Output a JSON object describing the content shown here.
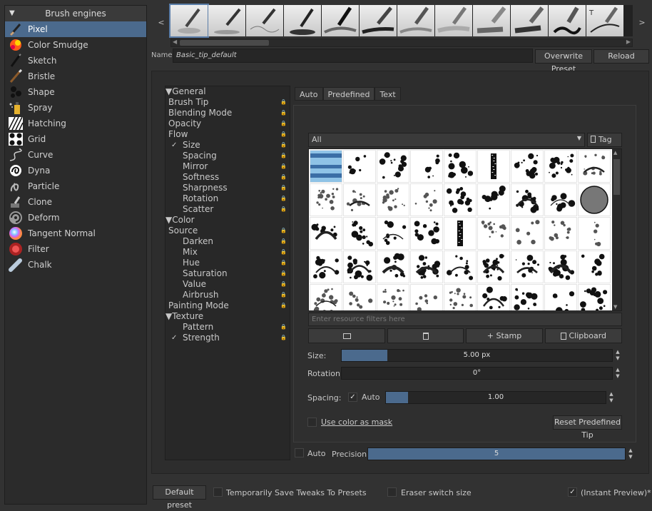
{
  "engines_panel": {
    "title": "Brush engines",
    "items": [
      {
        "label": "Pixel",
        "icon": "pixel-brush-icon",
        "selected": true
      },
      {
        "label": "Color Smudge",
        "icon": "color-smudge-icon"
      },
      {
        "label": "Sketch",
        "icon": "sketch-icon"
      },
      {
        "label": "Bristle",
        "icon": "bristle-icon"
      },
      {
        "label": "Shape",
        "icon": "shape-icon"
      },
      {
        "label": "Spray",
        "icon": "spray-icon"
      },
      {
        "label": "Hatching",
        "icon": "hatching-icon"
      },
      {
        "label": "Grid",
        "icon": "grid-icon"
      },
      {
        "label": "Curve",
        "icon": "curve-icon"
      },
      {
        "label": "Dyna",
        "icon": "dyna-icon"
      },
      {
        "label": "Particle",
        "icon": "particle-icon"
      },
      {
        "label": "Clone",
        "icon": "clone-icon"
      },
      {
        "label": "Deform",
        "icon": "deform-icon"
      },
      {
        "label": "Tangent Normal",
        "icon": "tangent-normal-icon"
      },
      {
        "label": "Filter",
        "icon": "filter-icon"
      },
      {
        "label": "Chalk",
        "icon": "chalk-icon"
      }
    ]
  },
  "preset_strip": {
    "prev_arrow": "<",
    "next_arrow": ">",
    "preset_count": 12
  },
  "name_row": {
    "label": "Name:",
    "value": "Basic_tip_default",
    "overwrite_button": "Overwrite Preset",
    "reload_button": "Reload"
  },
  "options": {
    "items": [
      {
        "type": "section",
        "label": "General"
      },
      {
        "type": "item",
        "label": "Brush Tip",
        "lock": true
      },
      {
        "type": "item",
        "label": "Blending Mode",
        "lock": true
      },
      {
        "type": "item",
        "label": "Opacity",
        "lock": true
      },
      {
        "type": "item",
        "label": "Flow",
        "lock": true
      },
      {
        "type": "sub",
        "label": "Size",
        "checked": true,
        "lock": true
      },
      {
        "type": "sub",
        "label": "Spacing",
        "lock": true
      },
      {
        "type": "sub",
        "label": "Mirror",
        "lock": true
      },
      {
        "type": "sub",
        "label": "Softness",
        "lock": true
      },
      {
        "type": "sub",
        "label": "Sharpness",
        "lock": true
      },
      {
        "type": "sub",
        "label": "Rotation",
        "lock": true
      },
      {
        "type": "sub",
        "label": "Scatter",
        "lock": true
      },
      {
        "type": "section",
        "label": "Color"
      },
      {
        "type": "item",
        "label": "Source",
        "lock": true
      },
      {
        "type": "sub",
        "label": "Darken",
        "lock": true
      },
      {
        "type": "sub",
        "label": "Mix",
        "lock": true
      },
      {
        "type": "sub",
        "label": "Hue",
        "lock": true
      },
      {
        "type": "sub",
        "label": "Saturation",
        "lock": true
      },
      {
        "type": "sub",
        "label": "Value",
        "lock": true
      },
      {
        "type": "sub",
        "label": "Airbrush",
        "lock": true
      },
      {
        "type": "item",
        "label": "Painting Mode",
        "lock": true
      },
      {
        "type": "section",
        "label": "Texture"
      },
      {
        "type": "sub",
        "label": "Pattern",
        "lock": true
      },
      {
        "type": "sub",
        "label": "Strength",
        "checked": true,
        "lock": true
      }
    ]
  },
  "tip_tabs": {
    "auto": "Auto",
    "predefined": "Predefined",
    "text": "Text"
  },
  "tip": {
    "tag_combo": "All",
    "tag_button": "Tag",
    "filter_placeholder": "Enter resource filters here",
    "stamp_button": "Stamp",
    "clipboard_button": "Clipboard",
    "size_label": "Size:",
    "size_value": "5.00 px",
    "size_fill": 0.17,
    "rotation_label": "Rotation:",
    "rotation_value": "0°",
    "spacing_label": "Spacing:",
    "spacing_auto_label": "Auto",
    "spacing_auto_checked": true,
    "spacing_value": "1.00",
    "spacing_fill": 0.1,
    "use_color_mask_label": "Use color as mask",
    "reset_button": "Reset Predefined Tip",
    "precision_auto_label": "Auto",
    "precision_label": "Precision:",
    "precision_value": "5",
    "precision_fill": 1.0
  },
  "bottom": {
    "default_preset_button": "Default preset",
    "temp_save_label": "Temporarily Save Tweaks To Presets",
    "eraser_switch_label": "Eraser switch size",
    "instant_preview_label": "(Instant Preview)*",
    "instant_preview_checked": true
  },
  "colors": {
    "accent": "#4b6a8d",
    "panel": "#2b2b2b",
    "background": "#323232"
  }
}
